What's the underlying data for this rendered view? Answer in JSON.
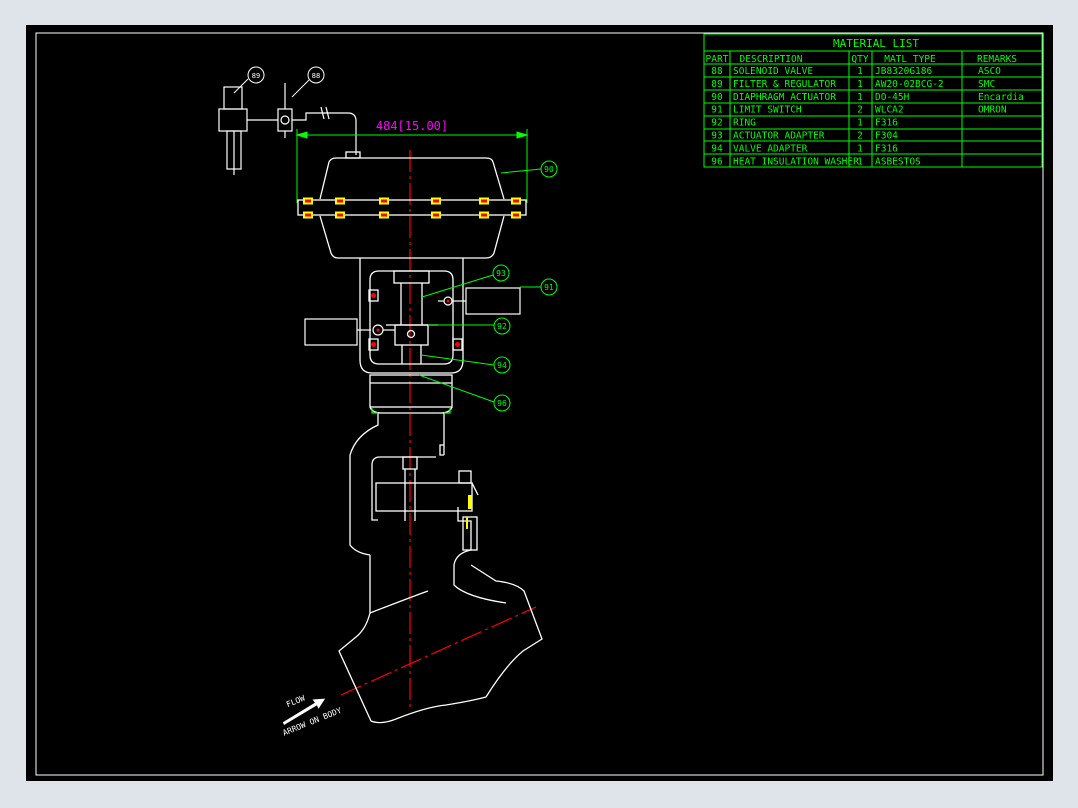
{
  "colors": {
    "background": "#000000",
    "outline": "#ffffff",
    "table": "#00ff00",
    "dimension": "#00ff00",
    "dimension_text": "#ff00ff",
    "centerline": "#ff0000",
    "callout": "#00ff00",
    "bolt": "#ffff00",
    "bolt_accent": "#ff0000"
  },
  "material_list": {
    "title": "MATERIAL   LIST",
    "headers": [
      "PART",
      "DESCRIPTION",
      "QTY",
      "MATL TYPE",
      "REMARKS"
    ],
    "rows": [
      {
        "part": "88",
        "description": "SOLENOID VALVE",
        "qty": "1",
        "matl": "JB8320G186",
        "remarks": "ASCO"
      },
      {
        "part": "89",
        "description": "FILTER & REGULATOR",
        "qty": "1",
        "matl": "AW20-02BCG-2",
        "remarks": "SMC"
      },
      {
        "part": "90",
        "description": "DIAPHRAGM ACTUATOR",
        "qty": "1",
        "matl": "DO-45H",
        "remarks": "Encardia"
      },
      {
        "part": "91",
        "description": "LIMIT SWITCH",
        "qty": "2",
        "matl": "WLCA2",
        "remarks": "OMRON"
      },
      {
        "part": "92",
        "description": "RING",
        "qty": "1",
        "matl": "F316",
        "remarks": ""
      },
      {
        "part": "93",
        "description": "ACTUATOR ADAPTER",
        "qty": "2",
        "matl": "F304",
        "remarks": ""
      },
      {
        "part": "94",
        "description": "VALVE ADAPTER",
        "qty": "1",
        "matl": "F316",
        "remarks": ""
      },
      {
        "part": "96",
        "description": "HEAT INSULATION WASHER",
        "qty": "1",
        "matl": "ASBESTOS",
        "remarks": ""
      }
    ]
  },
  "dimension": {
    "label": "484[15.00]"
  },
  "callouts": {
    "c89": "89",
    "c88": "88",
    "c90": "90",
    "c91": "91",
    "c92": "92",
    "c93": "93",
    "c94": "94",
    "c96": "96"
  },
  "flow_note": {
    "line1": "FLOW",
    "line2": "ARROW ON BODY"
  },
  "icons": {
    "flow_arrow": "flow-arrow-icon"
  }
}
